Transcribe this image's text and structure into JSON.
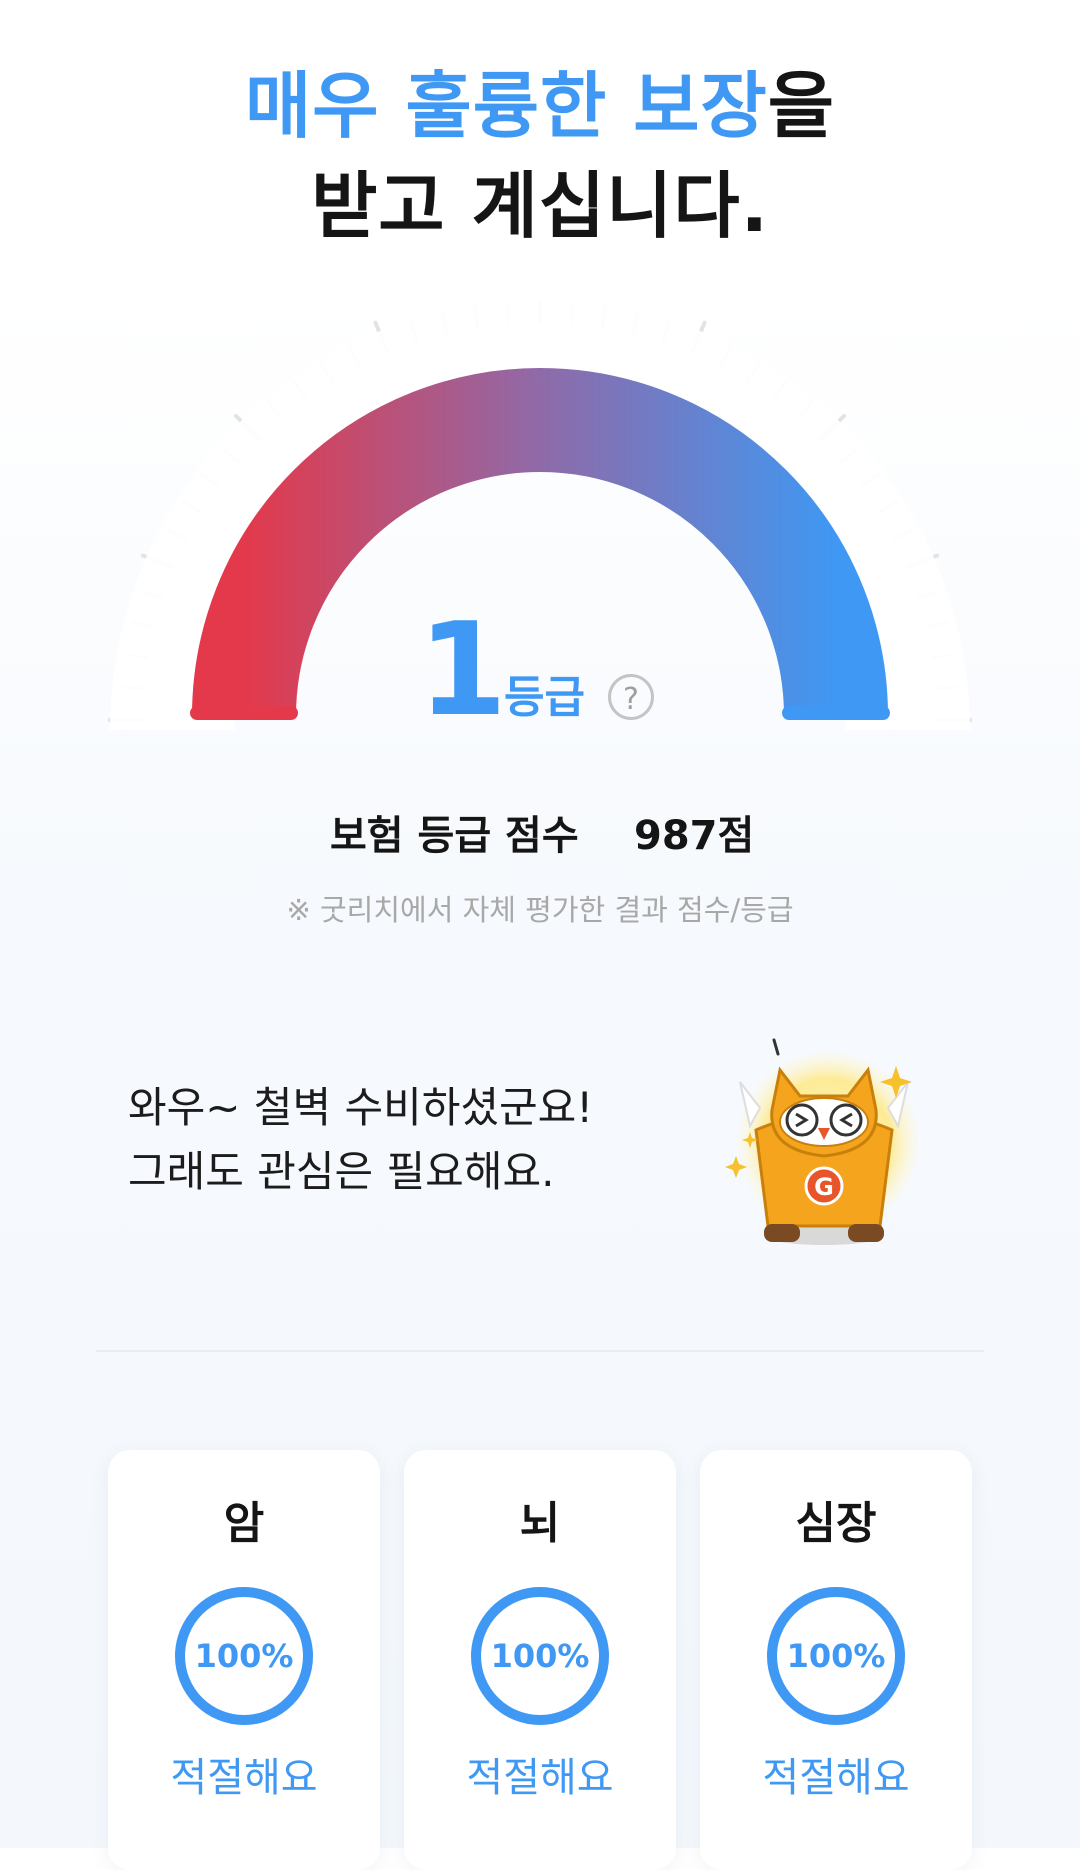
{
  "headline": {
    "accent": "매우 훌륭한 보장",
    "line1_rest": "을",
    "line2": "받고 계십니다."
  },
  "gauge": {
    "start_color": "#e3394b",
    "mid_color": "#8f6aa8",
    "end_color": "#3f98f3"
  },
  "grade": {
    "number": "1",
    "unit": "등급",
    "help_icon": "question-circle-icon",
    "help_glyph": "?"
  },
  "score": {
    "label": "보험 등급 점수",
    "value": "987점"
  },
  "footnote": "※ 굿리치에서 자체 평가한 결과 점수/등급",
  "message": {
    "line1": "와우~ 철벽 수비하셨군요!",
    "line2": "그래도 관심은 필요해요."
  },
  "mascot": {
    "icon": "mascot-owl-icon",
    "badge_letter": "G"
  },
  "categories": [
    {
      "title": "암",
      "percent": "100%",
      "percent_value": 100,
      "status": "적절해요"
    },
    {
      "title": "뇌",
      "percent": "100%",
      "percent_value": 100,
      "status": "적절해요"
    },
    {
      "title": "심장",
      "percent": "100%",
      "percent_value": 100,
      "status": "적절해요"
    }
  ],
  "colors": {
    "accent": "#3f98f3",
    "text_dark": "#151515",
    "muted": "#a8a8a8"
  }
}
